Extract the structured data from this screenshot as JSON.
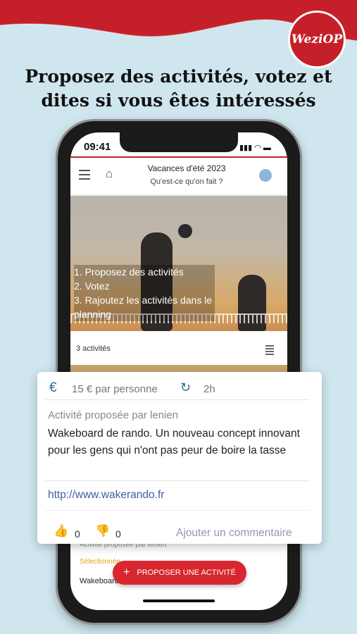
{
  "brand": {
    "logo_text": "WeziOP",
    "accent_color": "#c5202a"
  },
  "headline": {
    "line1": "Proposez des activités, votez et",
    "line2": "dites si vous êtes intéressés"
  },
  "status_bar": {
    "time": "09:41",
    "icons": "▮▮▮ ◠ ▬"
  },
  "app_bar": {
    "title": "Vacances d'été 2023",
    "subtitle": "Qu'est-ce qu'on fait ?",
    "menu_icon": "menu-icon",
    "home_icon": "home-icon",
    "account_icon": "account-icon"
  },
  "hero": {
    "steps": [
      "1. Proposez des activités",
      "2. Votez",
      "3. Rajoutez les activités dans le planning"
    ]
  },
  "activity_count": "3 activités",
  "card": {
    "price": "15 € par personne",
    "duration": "2h",
    "proposer": "Activité proposée par lenien",
    "description": "Wakeboard de rando. Un nouveau concept innovant pour les gens qui n'ont pas peur de boire la tasse",
    "link": "http://www.wakerando.fr",
    "likes": "0",
    "dislikes": "0",
    "comment_label": "Ajouter un commentaire"
  },
  "background_card": {
    "proposer": "Activité proposée par lenien",
    "selected": "Sélectionnée",
    "title": "Wakeboard de rando. Un nouveau concept"
  },
  "fab": {
    "label": "PROPOSER UNE ACTIVITÉ",
    "icon": "+"
  }
}
